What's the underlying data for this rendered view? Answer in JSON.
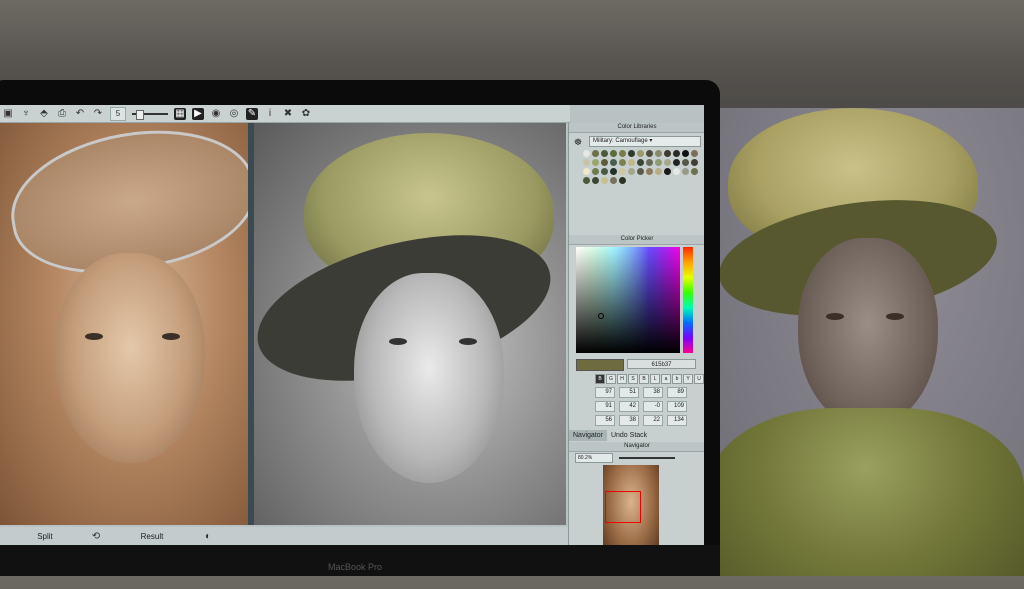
{
  "toolbar": {
    "brush_size": "5",
    "icons": [
      "layers-icon",
      "stamp-icon",
      "fill-icon",
      "print-icon",
      "undo-icon",
      "redo-icon",
      "size-box",
      "brush-size-slider",
      "tile-icon",
      "play-icon",
      "eye-icon",
      "eye-alt-icon",
      "pen-icon",
      "info-icon",
      "cross-icon",
      "settings-icon"
    ]
  },
  "bottombar": {
    "split_label": "Split",
    "result_label": "Result"
  },
  "color_libraries": {
    "title": "Color Libraries",
    "selected": "Military: Camouflage",
    "swatches": [
      "#e8e6df",
      "#6e6e48",
      "#4a5a3a",
      "#5b6b3b",
      "#7a7a4a",
      "#2e3a2a",
      "#9a9a6a",
      "#4e4e3a",
      "#8a8a6a",
      "#3a3a2e",
      "#2a2a24",
      "#111111",
      "#7f6d5a",
      "#c9c3a6",
      "#9aa66a",
      "#5c5c3c",
      "#4a5e4e",
      "#7a8050",
      "#c2b98a",
      "#3c4634",
      "#6a6a5a",
      "#8e9a72",
      "#a8a88a",
      "#222222",
      "#565646",
      "#3e3e34",
      "#f0e9c9",
      "#6f7a4f",
      "#485a44",
      "#26302a",
      "#d2c6a0",
      "#a6a68a",
      "#5a5a4a",
      "#8c7c5c",
      "#b7ad86",
      "#1a1a18",
      "#e6e6e6",
      "#9a9a8a",
      "#6a7050",
      "#4b5a3a",
      "#3a4636",
      "#c6c08e",
      "#7a7060",
      "#2c3426"
    ]
  },
  "color_picker": {
    "title": "Color Picker",
    "hex": "615b37",
    "channels": [
      "B",
      "G",
      "H",
      "S",
      "B",
      "L",
      "a",
      "b",
      "Y",
      "U",
      "V"
    ],
    "values": [
      "97",
      "51",
      "38",
      "89",
      "91",
      "42",
      "-0",
      "109",
      "56",
      "38",
      "22",
      "134"
    ]
  },
  "navigator": {
    "tab_navigator": "Navigator",
    "tab_undo": "Undo Stack",
    "title": "Navigator",
    "zoom": "80.2%"
  },
  "laptop_label": "MacBook Pro"
}
